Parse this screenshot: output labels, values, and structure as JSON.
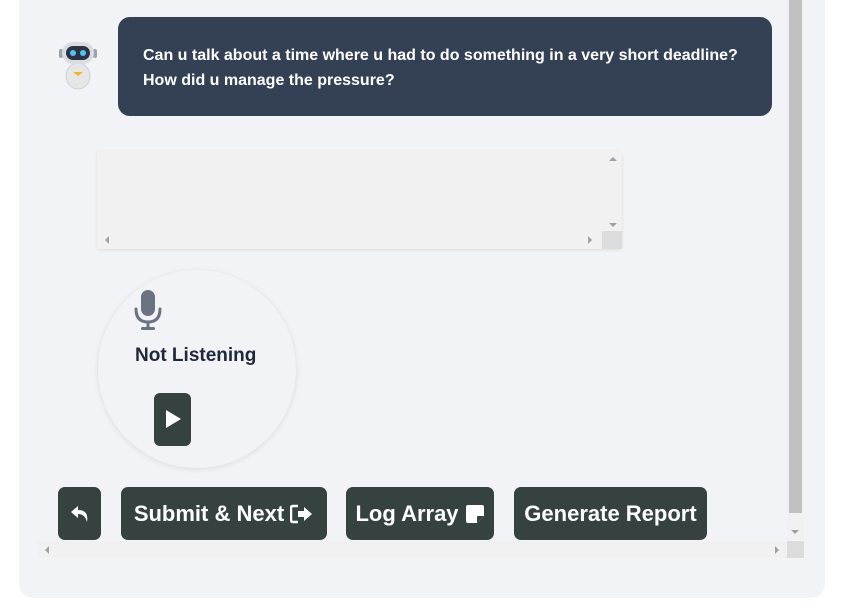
{
  "chat": {
    "message": "Can u talk about a time where u had to do something in a very short deadline? How did u manage the pressure?"
  },
  "answer_box": {
    "value": "",
    "placeholder": ""
  },
  "recorder": {
    "status_label": "Not Listening",
    "mic_icon": "microphone-icon",
    "play_icon": "play-icon"
  },
  "actions": {
    "back_icon": "undo-arrow-icon",
    "submit_label": "Submit & Next",
    "submit_icon": "sign-out-arrow-icon",
    "log_label": "Log Array",
    "log_icon": "sticky-note-icon",
    "report_label": "Generate Report"
  },
  "colors": {
    "bubble_bg": "#344155",
    "button_bg": "#354240",
    "panel_bg": "#f2f3f6",
    "bot_eye": "#4fc3f7"
  }
}
